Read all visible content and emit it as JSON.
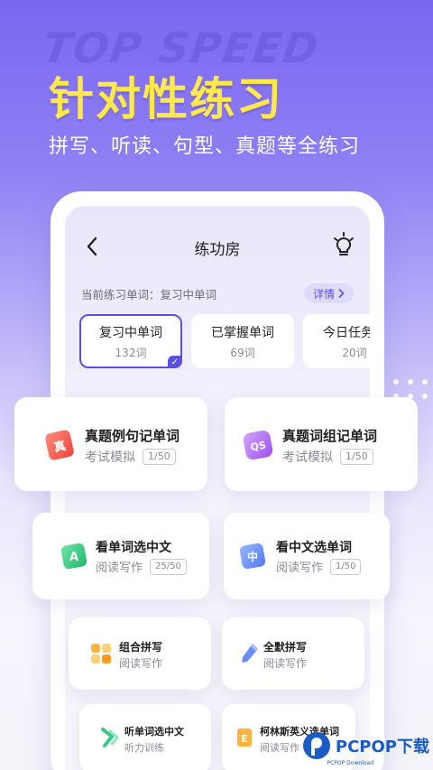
{
  "banner": {
    "watermark": "TOP SPEED",
    "headline": "针对性练习",
    "subline": "拼写、听读、句型、真题等全练习"
  },
  "nav": {
    "title": "练功房"
  },
  "current": {
    "label": "当前练习单词：复习中单词",
    "detail": "详情"
  },
  "tabs": [
    {
      "name": "复习中单词",
      "count": "132词"
    },
    {
      "name": "已掌握单词",
      "count": "69词"
    },
    {
      "name": "今日任务词",
      "count": "20词"
    }
  ],
  "cards": [
    {
      "title": "真题例句记单词",
      "sub": "考试模拟",
      "badge": "1/50",
      "icon": "exam-scroll-icon"
    },
    {
      "title": "真题词组记单词",
      "sub": "考试模拟",
      "badge": "1/50",
      "icon": "phrase-qs-icon"
    },
    {
      "title": "看单词选中文",
      "sub": "阅读写作",
      "badge": "25/50",
      "icon": "letter-a-icon"
    },
    {
      "title": "看中文选单词",
      "sub": "阅读写作",
      "badge": "1/50",
      "icon": "chinese-char-icon"
    },
    {
      "title": "组合拼写",
      "sub": "阅读写作",
      "icon": "puzzle-icon"
    },
    {
      "title": "全默拼写",
      "sub": "阅读写作",
      "icon": "pencil-icon"
    },
    {
      "title": "听单词选中文",
      "sub": "听力训练",
      "icon": "sound-wave-icon"
    },
    {
      "title": "柯林斯英义选单词",
      "sub": "阅读写作",
      "icon": "book-e-icon"
    }
  ],
  "brand": {
    "name": "PCPOP下载",
    "small": "PCPOP Download"
  }
}
